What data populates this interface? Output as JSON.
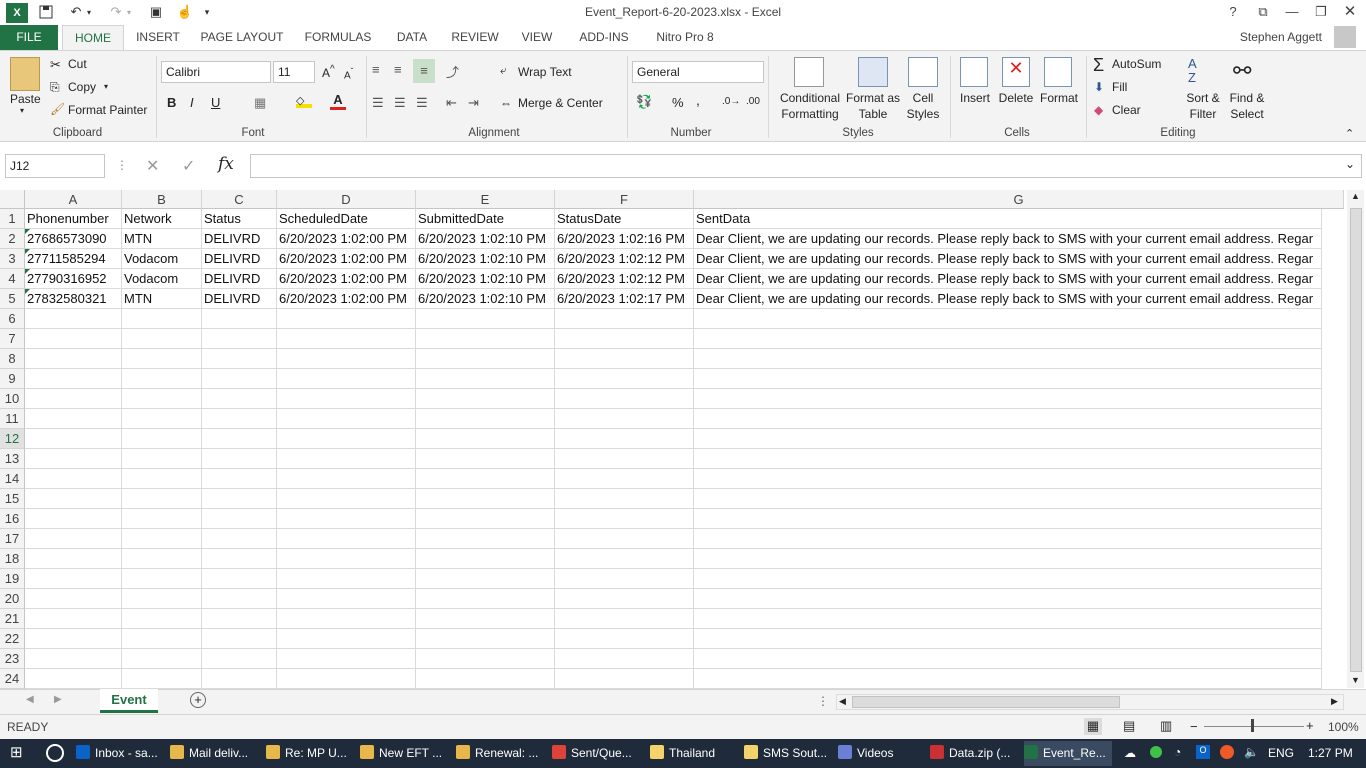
{
  "window": {
    "title": "Event_Report-6-20-2023.xlsx - Excel",
    "help": "?",
    "user": "Stephen Aggett"
  },
  "tabs": [
    "FILE",
    "HOME",
    "INSERT",
    "PAGE LAYOUT",
    "FORMULAS",
    "DATA",
    "REVIEW",
    "VIEW",
    "ADD-INS",
    "Nitro Pro 8"
  ],
  "clipboard": {
    "paste": "Paste",
    "cut": "Cut",
    "copy": "Copy",
    "format_painter": "Format Painter",
    "label": "Clipboard"
  },
  "font": {
    "name": "Calibri",
    "size": "11",
    "bold": "B",
    "italic": "I",
    "underline": "U",
    "label": "Font"
  },
  "alignment": {
    "wrap": "Wrap Text",
    "merge": "Merge & Center",
    "label": "Alignment"
  },
  "number": {
    "format": "General",
    "percent": "%",
    "comma": ",",
    "label": "Number"
  },
  "styles": {
    "conditional": [
      "Conditional",
      "Formatting"
    ],
    "format_table": [
      "Format as",
      "Table"
    ],
    "cell_styles": [
      "Cell",
      "Styles"
    ],
    "label": "Styles"
  },
  "cells": {
    "insert": "Insert",
    "delete": "Delete",
    "format": "Format",
    "label": "Cells"
  },
  "editing": {
    "autosum": "AutoSum",
    "fill": "Fill",
    "clear": "Clear",
    "sort": [
      "Sort &",
      "Filter"
    ],
    "find": [
      "Find &",
      "Select"
    ],
    "label": "Editing"
  },
  "formula_bar": {
    "name_box": "J12",
    "fx": "fx",
    "value": ""
  },
  "sheet": {
    "columns": [
      "A",
      "B",
      "C",
      "D",
      "E",
      "F",
      "G"
    ],
    "rows": [
      [
        "Phonenumber",
        "Network",
        "Status",
        "ScheduledDate",
        "SubmittedDate",
        "StatusDate",
        "SentData"
      ],
      [
        "27686573090",
        "MTN",
        "DELIVRD",
        "6/20/2023 1:02:00 PM",
        "6/20/2023 1:02:10 PM",
        "6/20/2023 1:02:16 PM",
        "Dear Client, we are updating our records. Please reply back to SMS with your current email address. Regar"
      ],
      [
        "27711585294",
        "Vodacom",
        "DELIVRD",
        "6/20/2023 1:02:00 PM",
        "6/20/2023 1:02:10 PM",
        "6/20/2023 1:02:12 PM",
        "Dear Client, we are updating our records. Please reply back to SMS with your current email address. Regar"
      ],
      [
        "27790316952",
        "Vodacom",
        "DELIVRD",
        "6/20/2023 1:02:00 PM",
        "6/20/2023 1:02:10 PM",
        "6/20/2023 1:02:12 PM",
        "Dear Client, we are updating our records. Please reply back to SMS with your current email address. Regar"
      ],
      [
        "27832580321",
        "MTN",
        "DELIVRD",
        "6/20/2023 1:02:00 PM",
        "6/20/2023 1:02:10 PM",
        "6/20/2023 1:02:17 PM",
        "Dear Client, we are updating our records. Please reply back to SMS with your current email address. Regar"
      ]
    ],
    "row_numbers": [
      "1",
      "2",
      "3",
      "4",
      "5",
      "6",
      "7",
      "8",
      "9",
      "10",
      "11",
      "12",
      "13",
      "14",
      "15",
      "16",
      "17",
      "18",
      "19",
      "20",
      "21",
      "22",
      "23",
      "24"
    ],
    "sheet_tab": "Event"
  },
  "status": {
    "ready": "READY",
    "zoom": "100%"
  },
  "taskbar": {
    "items": [
      "Inbox - sa...",
      "Mail deliv...",
      "Re: MP U...",
      "New EFT ...",
      "Renewal: ...",
      "Sent/Que...",
      "Thailand",
      "SMS Sout...",
      "Videos",
      "Data.zip (...",
      "Event_Re..."
    ],
    "lang": "ENG",
    "time": "1:27 PM"
  },
  "colors": {
    "excel_green": "#217346",
    "taskbar": "#1f2a3a"
  }
}
